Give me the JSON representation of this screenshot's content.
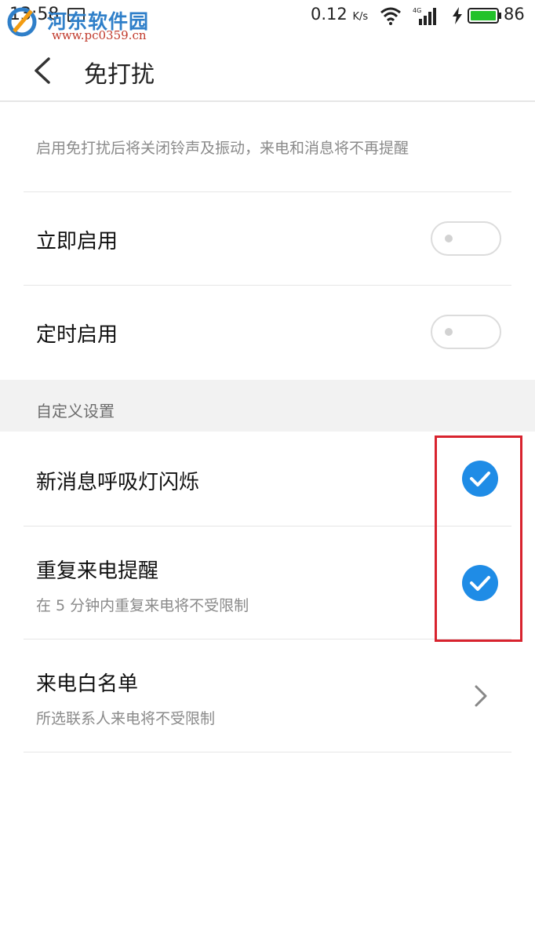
{
  "status_bar": {
    "time": "13:58",
    "net_speed": "0.12",
    "net_speed_unit": "K/s",
    "battery_level": "86",
    "watermark_title": "河东软件园",
    "watermark_url": "www.pc0359.cn",
    "icons": [
      "gallery-icon",
      "wifi-icon",
      "signal-icon",
      "bolt-icon",
      "battery-icon"
    ],
    "battery_color": "#22c22a"
  },
  "header": {
    "title": "免打扰",
    "back_icon": "chevron-left-icon"
  },
  "description": "启用免打扰后将关闭铃声及振动，来电和消息将不再提醒",
  "toggles": [
    {
      "label": "立即启用",
      "on": false
    },
    {
      "label": "定时启用",
      "on": false
    }
  ],
  "section": {
    "label": "自定义设置"
  },
  "custom_items": [
    {
      "title": "新消息呼吸灯闪烁",
      "subtitle": "",
      "checked": true
    },
    {
      "title": "重复来电提醒",
      "subtitle": "在 5 分钟内重复来电将不受限制",
      "checked": true
    }
  ],
  "whitelist": {
    "title": "来电白名单",
    "subtitle": "所选联系人来电将不受限制",
    "icon": "chevron-right-icon"
  },
  "colors": {
    "accent": "#1f8ce6",
    "highlight": "#d8232e"
  }
}
